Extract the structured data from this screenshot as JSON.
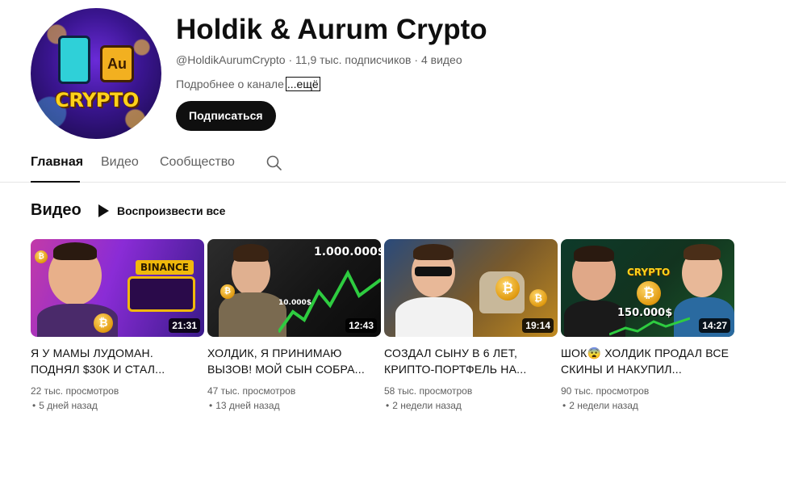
{
  "channel": {
    "name": "Holdik & Aurum Crypto",
    "handle": "@HoldikAurumCrypto",
    "subscribers": "11,9 тыс. подписчиков",
    "video_count": "4 видео",
    "separator": "·",
    "description": "Подробнее о канале",
    "more_label": "...ещё",
    "subscribe_label": "Подписаться",
    "avatar_text": "CRYPTO",
    "avatar_badge": "Au"
  },
  "tabs": [
    {
      "label": "Главная",
      "active": true
    },
    {
      "label": "Видео",
      "active": false
    },
    {
      "label": "Сообщество",
      "active": false
    }
  ],
  "section": {
    "title": "Видео",
    "play_all_label": "Воспроизвести все"
  },
  "videos": [
    {
      "title": "Я У МАМЫ ЛУДОМАН. ПОДНЯЛ $30K И СТАЛ...",
      "views": "22 тыс. просмотров",
      "age": "5 дней назад",
      "duration": "21:31",
      "thumb_text": "BINANCE"
    },
    {
      "title": "ХОЛДИК, Я ПРИНИМАЮ ВЫЗОВ! МОЙ СЫН СОБРА...",
      "views": "47 тыс. просмотров",
      "age": "13 дней назад",
      "duration": "12:43",
      "thumb_text": "1.000.000$",
      "thumb_text_2": "10.000$"
    },
    {
      "title": "СОЗДАЛ СЫНУ В 6 ЛЕТ, КРИПТО-ПОРТФЕЛЬ НА...",
      "views": "58 тыс. просмотров",
      "age": "2 недели назад",
      "duration": "19:14"
    },
    {
      "title": "ШОК😨 ХОЛДИК ПРОДАЛ ВСЕ СКИНЫ И НАКУПИЛ...",
      "views": "90 тыс. просмотров",
      "age": "2 недели назад",
      "duration": "14:27",
      "thumb_text": "CRYPTO",
      "thumb_text_2": "150.000$"
    }
  ],
  "colors": {
    "text_primary": "#0f0f0f",
    "text_secondary": "#606060",
    "subscribe_bg": "#0f0f0f",
    "divider": "#e5e5e5"
  }
}
